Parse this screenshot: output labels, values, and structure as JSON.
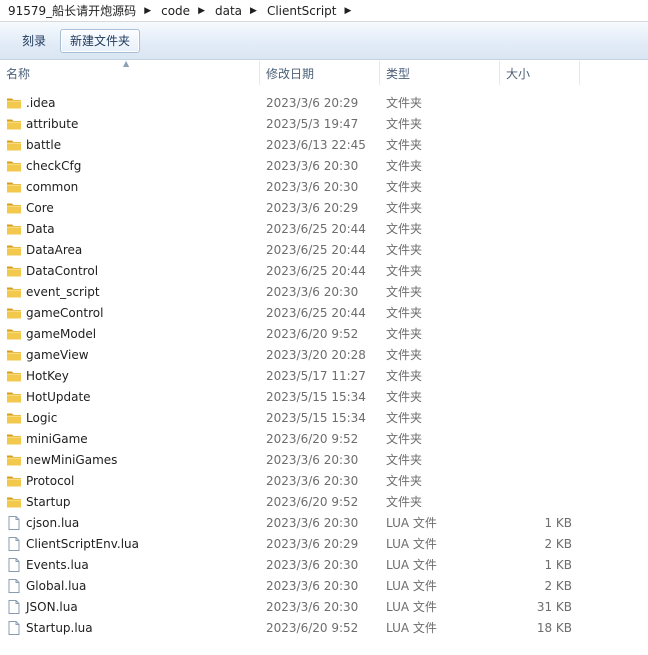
{
  "address": {
    "crumbs": [
      "91579_船长请开炮源码",
      "code",
      "data",
      "ClientScript"
    ]
  },
  "toolbar": {
    "burn_label": "刻录",
    "new_folder_label": "新建文件夹"
  },
  "columns": {
    "name": "名称",
    "date": "修改日期",
    "type": "类型",
    "size": "大小"
  },
  "icons": {
    "folder": "folder-icon",
    "file": "file-icon",
    "folder_color": "#e8b730",
    "file_color": "#8a9bb0"
  },
  "files": [
    {
      "name": ".idea",
      "date": "2023/3/6 20:29",
      "type": "文件夹",
      "size": "",
      "kind": "folder"
    },
    {
      "name": "attribute",
      "date": "2023/5/3 19:47",
      "type": "文件夹",
      "size": "",
      "kind": "folder"
    },
    {
      "name": "battle",
      "date": "2023/6/13 22:45",
      "type": "文件夹",
      "size": "",
      "kind": "folder"
    },
    {
      "name": "checkCfg",
      "date": "2023/3/6 20:30",
      "type": "文件夹",
      "size": "",
      "kind": "folder"
    },
    {
      "name": "common",
      "date": "2023/3/6 20:30",
      "type": "文件夹",
      "size": "",
      "kind": "folder"
    },
    {
      "name": "Core",
      "date": "2023/3/6 20:29",
      "type": "文件夹",
      "size": "",
      "kind": "folder"
    },
    {
      "name": "Data",
      "date": "2023/6/25 20:44",
      "type": "文件夹",
      "size": "",
      "kind": "folder"
    },
    {
      "name": "DataArea",
      "date": "2023/6/25 20:44",
      "type": "文件夹",
      "size": "",
      "kind": "folder"
    },
    {
      "name": "DataControl",
      "date": "2023/6/25 20:44",
      "type": "文件夹",
      "size": "",
      "kind": "folder"
    },
    {
      "name": "event_script",
      "date": "2023/3/6 20:30",
      "type": "文件夹",
      "size": "",
      "kind": "folder"
    },
    {
      "name": "gameControl",
      "date": "2023/6/25 20:44",
      "type": "文件夹",
      "size": "",
      "kind": "folder"
    },
    {
      "name": "gameModel",
      "date": "2023/6/20 9:52",
      "type": "文件夹",
      "size": "",
      "kind": "folder"
    },
    {
      "name": "gameView",
      "date": "2023/3/20 20:28",
      "type": "文件夹",
      "size": "",
      "kind": "folder"
    },
    {
      "name": "HotKey",
      "date": "2023/5/17 11:27",
      "type": "文件夹",
      "size": "",
      "kind": "folder"
    },
    {
      "name": "HotUpdate",
      "date": "2023/5/15 15:34",
      "type": "文件夹",
      "size": "",
      "kind": "folder"
    },
    {
      "name": "Logic",
      "date": "2023/5/15 15:34",
      "type": "文件夹",
      "size": "",
      "kind": "folder"
    },
    {
      "name": "miniGame",
      "date": "2023/6/20 9:52",
      "type": "文件夹",
      "size": "",
      "kind": "folder"
    },
    {
      "name": "newMiniGames",
      "date": "2023/3/6 20:30",
      "type": "文件夹",
      "size": "",
      "kind": "folder"
    },
    {
      "name": "Protocol",
      "date": "2023/3/6 20:30",
      "type": "文件夹",
      "size": "",
      "kind": "folder"
    },
    {
      "name": "Startup",
      "date": "2023/6/20 9:52",
      "type": "文件夹",
      "size": "",
      "kind": "folder"
    },
    {
      "name": "cjson.lua",
      "date": "2023/3/6 20:30",
      "type": "LUA 文件",
      "size": "1 KB",
      "kind": "file"
    },
    {
      "name": "ClientScriptEnv.lua",
      "date": "2023/3/6 20:29",
      "type": "LUA 文件",
      "size": "2 KB",
      "kind": "file"
    },
    {
      "name": "Events.lua",
      "date": "2023/3/6 20:30",
      "type": "LUA 文件",
      "size": "1 KB",
      "kind": "file"
    },
    {
      "name": "Global.lua",
      "date": "2023/3/6 20:30",
      "type": "LUA 文件",
      "size": "2 KB",
      "kind": "file"
    },
    {
      "name": "JSON.lua",
      "date": "2023/3/6 20:30",
      "type": "LUA 文件",
      "size": "31 KB",
      "kind": "file"
    },
    {
      "name": "Startup.lua",
      "date": "2023/6/20 9:52",
      "type": "LUA 文件",
      "size": "18 KB",
      "kind": "file"
    }
  ]
}
